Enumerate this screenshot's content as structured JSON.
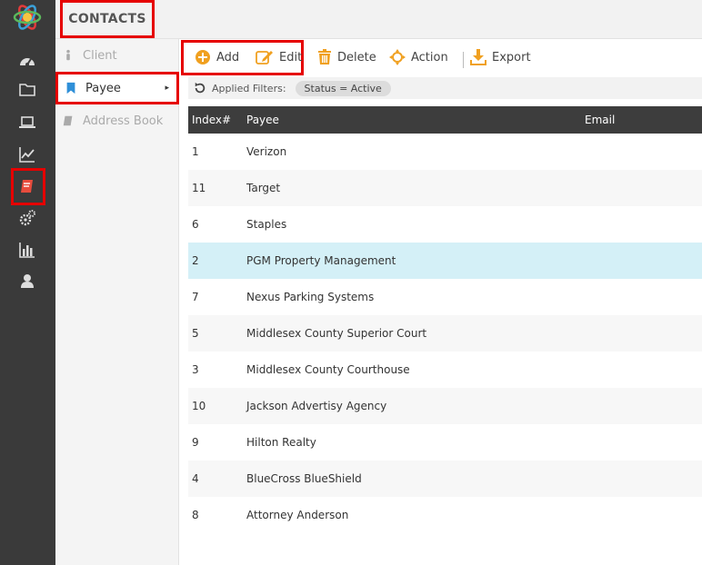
{
  "colors": {
    "rail": "#3a3a3a",
    "highlight": "#e60000",
    "accent": "#f0a020",
    "selected_row": "#d4f0f7"
  },
  "rail": {
    "items": [
      {
        "icon": "dashboard-icon"
      },
      {
        "icon": "folder-icon"
      },
      {
        "icon": "laptop-icon"
      },
      {
        "icon": "chart-line-icon"
      },
      {
        "icon": "contacts-book-icon",
        "active": true
      },
      {
        "icon": "gears-icon"
      },
      {
        "icon": "bar-chart-icon"
      },
      {
        "icon": "user-icon"
      }
    ]
  },
  "header": {
    "title": "CONTACTS"
  },
  "subnav": {
    "items": [
      {
        "label": "Client",
        "icon": "person-icon"
      },
      {
        "label": "Payee",
        "icon": "bookmark-icon",
        "active": true
      },
      {
        "label": "Address Book",
        "icon": "book-icon"
      }
    ]
  },
  "toolbar": {
    "add_label": "Add",
    "edit_label": "Edit",
    "delete_label": "Delete",
    "action_label": "Action",
    "export_label": "Export"
  },
  "filters": {
    "label": "Applied Filters:",
    "chip": "Status = Active"
  },
  "table": {
    "columns": [
      "Index#",
      "Payee",
      "Email"
    ],
    "rows": [
      {
        "index": "1",
        "payee": "Verizon"
      },
      {
        "index": "11",
        "payee": "Target"
      },
      {
        "index": "6",
        "payee": "Staples"
      },
      {
        "index": "2",
        "payee": "PGM Property Management",
        "selected": true
      },
      {
        "index": "7",
        "payee": "Nexus Parking Systems"
      },
      {
        "index": "5",
        "payee": "Middlesex County Superior Court"
      },
      {
        "index": "3",
        "payee": "Middlesex County Courthouse"
      },
      {
        "index": "10",
        "payee": "Jackson Advertisy Agency"
      },
      {
        "index": "9",
        "payee": "Hilton Realty"
      },
      {
        "index": "4",
        "payee": "BlueCross BlueShield"
      },
      {
        "index": "8",
        "payee": "Attorney Anderson"
      }
    ]
  }
}
